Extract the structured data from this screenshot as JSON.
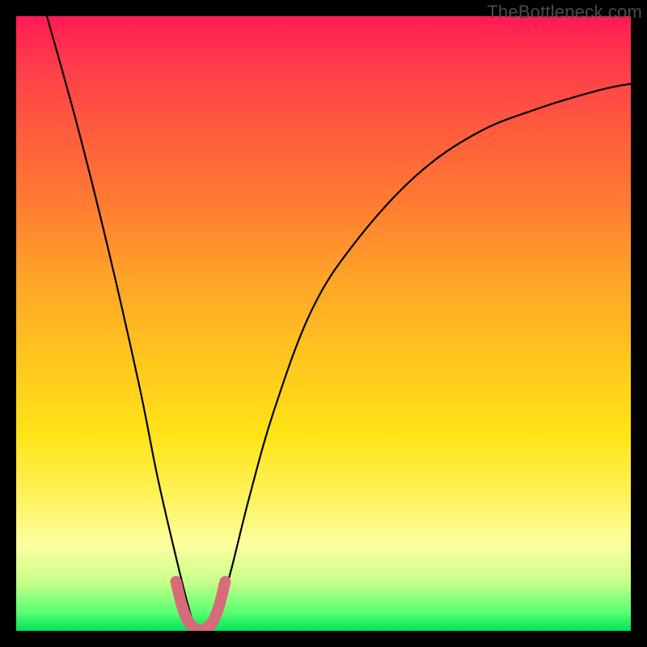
{
  "watermark": "TheBottleneck.com",
  "colors": {
    "curve": "#000000",
    "pink_segment": "#d86a7a",
    "frame": "#000000"
  },
  "chart_data": {
    "type": "line",
    "title": "",
    "xlabel": "",
    "ylabel": "",
    "xlim": [
      0,
      100
    ],
    "ylim": [
      0,
      100
    ],
    "grid": false,
    "legend": false,
    "series": [
      {
        "name": "curve",
        "x": [
          5,
          10,
          15,
          20,
          23,
          26,
          28,
          29,
          30,
          31,
          32,
          33,
          35,
          38,
          42,
          48,
          55,
          65,
          75,
          85,
          95,
          100
        ],
        "y": [
          100,
          82,
          62,
          40,
          25,
          12,
          4,
          1,
          0,
          0,
          1,
          3,
          10,
          22,
          36,
          52,
          63,
          74,
          81,
          85,
          88,
          89
        ]
      },
      {
        "name": "pink-valley",
        "x": [
          26,
          27,
          28,
          29,
          30,
          31,
          32,
          33,
          34
        ],
        "y": [
          8,
          4,
          1.5,
          0.5,
          0,
          0.5,
          1.5,
          4,
          8
        ]
      }
    ],
    "annotations": []
  }
}
